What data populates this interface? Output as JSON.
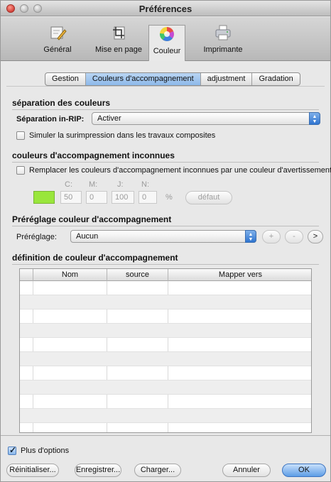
{
  "window": {
    "title": "Préférences"
  },
  "toolbar": {
    "items": [
      {
        "label": "Général",
        "icon": "pencil-doc-icon"
      },
      {
        "label": "Mise en page",
        "icon": "crop-page-icon"
      },
      {
        "label": "Couleur",
        "icon": "color-wheel-icon",
        "active": true
      },
      {
        "label": "Imprimante",
        "icon": "printer-icon"
      }
    ]
  },
  "tabs": [
    {
      "label": "Gestion"
    },
    {
      "label": "Couleurs d'accompagnement",
      "active": true
    },
    {
      "label": "adjustment"
    },
    {
      "label": "Gradation"
    }
  ],
  "separation": {
    "heading": "séparation des couleurs",
    "inrip_label": "Séparation in-RIP:",
    "inrip_value": "Activer",
    "simulate_label": "Simuler la surimpression dans les travaux composites",
    "simulate_checked": false
  },
  "unknown": {
    "heading": "couleurs d'accompagnement inconnues",
    "replace_label": "Remplacer les couleurs d'accompagnement inconnues par une couleur d'avertissement",
    "replace_checked": false,
    "swatch_color": "#99e63c",
    "channels": [
      {
        "label": "C:",
        "value": "50"
      },
      {
        "label": "M:",
        "value": "0"
      },
      {
        "label": "J:",
        "value": "100"
      },
      {
        "label": "N:",
        "value": "0"
      }
    ],
    "percent": "%",
    "default_button": "défaut"
  },
  "preset": {
    "heading": "Préréglage couleur d'accompagnement",
    "label": "Préréglage:",
    "value": "Aucun",
    "add": "+",
    "remove": "-",
    "more": ">"
  },
  "definition": {
    "heading": "définition de couleur d'accompagnement",
    "columns": [
      "Nom",
      "source",
      "Mapper vers"
    ]
  },
  "footer": {
    "more_options": "Plus d'options",
    "more_options_checked": true,
    "reset": "Réinitialiser...",
    "save": "Enregistrer...",
    "load": "Charger...",
    "cancel": "Annuler",
    "ok": "OK"
  },
  "colors": {
    "accent": "#5d9de6",
    "tab_active": "#8db9ea",
    "swatch": "#99e63c"
  }
}
